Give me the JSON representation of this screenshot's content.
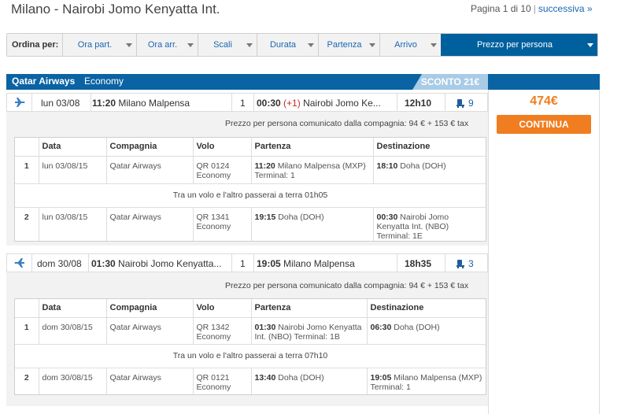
{
  "header": {
    "route_title": "Milano - Nairobi Jomo Kenyatta Int.",
    "pagination": "Pagina 1 di 10",
    "separator": "|",
    "next_link": "successiva »"
  },
  "sort_bar": {
    "label": "Ordina per:",
    "items": [
      "Ora part.",
      "Ora arr.",
      "Scali",
      "Durata",
      "Partenza",
      "Arrivo",
      "Prezzo per persona"
    ],
    "active_index": 6
  },
  "offer": {
    "airline": "Qatar Airways",
    "class": "Economy",
    "discount": "SCONTO 21€",
    "price": "474€",
    "continue_label": "CONTINUA",
    "colors": {
      "header_blue": "#0a63a3",
      "accent_orange": "#f07d1f",
      "discount_bg": "#a8cbe6"
    }
  },
  "outbound": {
    "icon": "plane-depart-icon",
    "date": "lun 03/08",
    "dep_time": "11:20",
    "dep_city": "Milano Malpensa",
    "stops": "1",
    "arr_time": "00:30",
    "day_offset": "(+1)",
    "arr_city": "Nairobi Jomo Ke...",
    "duration": "12h10",
    "seats": "9",
    "price_info": "Prezzo per persona comunicato dalla compagnia: 94 € + 153 € tax",
    "columns": [
      "",
      "Data",
      "Compagnia",
      "Volo",
      "Partenza",
      "Destinazione"
    ],
    "segments": [
      {
        "n": "1",
        "date": "lun 03/08/15",
        "carrier": "Qatar Airways",
        "flight": "QR 0124",
        "class": "Economy",
        "dep_time": "11:20",
        "dep_place": "Milano Malpensa (MXP) Terminal: 1",
        "arr_time": "18:10",
        "arr_place": "Doha (DOH)"
      },
      {
        "n": "2",
        "date": "lun 03/08/15",
        "carrier": "Qatar Airways",
        "flight": "QR 1341",
        "class": "Economy",
        "dep_time": "19:15",
        "dep_place": "Doha (DOH)",
        "arr_time": "00:30",
        "arr_place": "Nairobi Jomo Kenyatta Int. (NBO) Terminal: 1E"
      }
    ],
    "layover": "Tra un volo e l'altro passerai a terra 01h05"
  },
  "inbound": {
    "icon": "plane-return-icon",
    "date": "dom 30/08",
    "dep_time": "01:30",
    "dep_city": "Nairobi Jomo Kenyatta...",
    "stops": "1",
    "arr_time": "19:05",
    "arr_city": "Milano Malpensa",
    "duration": "18h35",
    "seats": "3",
    "price_info": "Prezzo per persona comunicato dalla compagnia: 94 € + 153 € tax",
    "columns": [
      "",
      "Data",
      "Compagnia",
      "Volo",
      "Partenza",
      "Destinazione"
    ],
    "segments": [
      {
        "n": "1",
        "date": "dom 30/08/15",
        "carrier": "Qatar Airways",
        "flight": "QR 1342",
        "class": "Economy",
        "dep_time": "01:30",
        "dep_place": "Nairobi Jomo Kenyatta Int. (NBO) Terminal: 1B",
        "arr_time": "06:30",
        "arr_place": "Doha (DOH)"
      },
      {
        "n": "2",
        "date": "dom 30/08/15",
        "carrier": "Qatar Airways",
        "flight": "QR 0121",
        "class": "Economy",
        "dep_time": "13:40",
        "dep_place": "Doha (DOH)",
        "arr_time": "19:05",
        "arr_place": "Milano Malpensa (MXP) Terminal: 1"
      }
    ],
    "layover": "Tra un volo e l'altro passerai a terra 07h10"
  }
}
